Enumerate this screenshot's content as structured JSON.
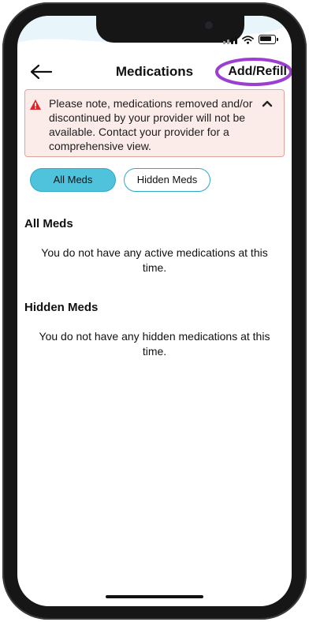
{
  "header": {
    "title": "Medications",
    "add_refill_label": "Add/Refill",
    "highlight_color": "#9b3fd0"
  },
  "alert": {
    "message": "Please note, medications removed and/or discontinued by your provider will not be available. Contact your provider for a comprehensive view.",
    "icon": "warning-triangle-icon",
    "icon_color": "#e0242a",
    "background": "#fbecea",
    "border_color": "#e2a39c"
  },
  "filters": {
    "active": "All Meds",
    "options": [
      "All Meds",
      "Hidden Meds"
    ],
    "accent_color": "#4fc3dc"
  },
  "sections": [
    {
      "heading": "All Meds",
      "empty_message": "You do not have any active medications at this time."
    },
    {
      "heading": "Hidden Meds",
      "empty_message": "You do not have any hidden medications at this time."
    }
  ],
  "status_bar": {
    "icons": [
      "signal-icon",
      "wifi-icon",
      "battery-icon"
    ]
  }
}
